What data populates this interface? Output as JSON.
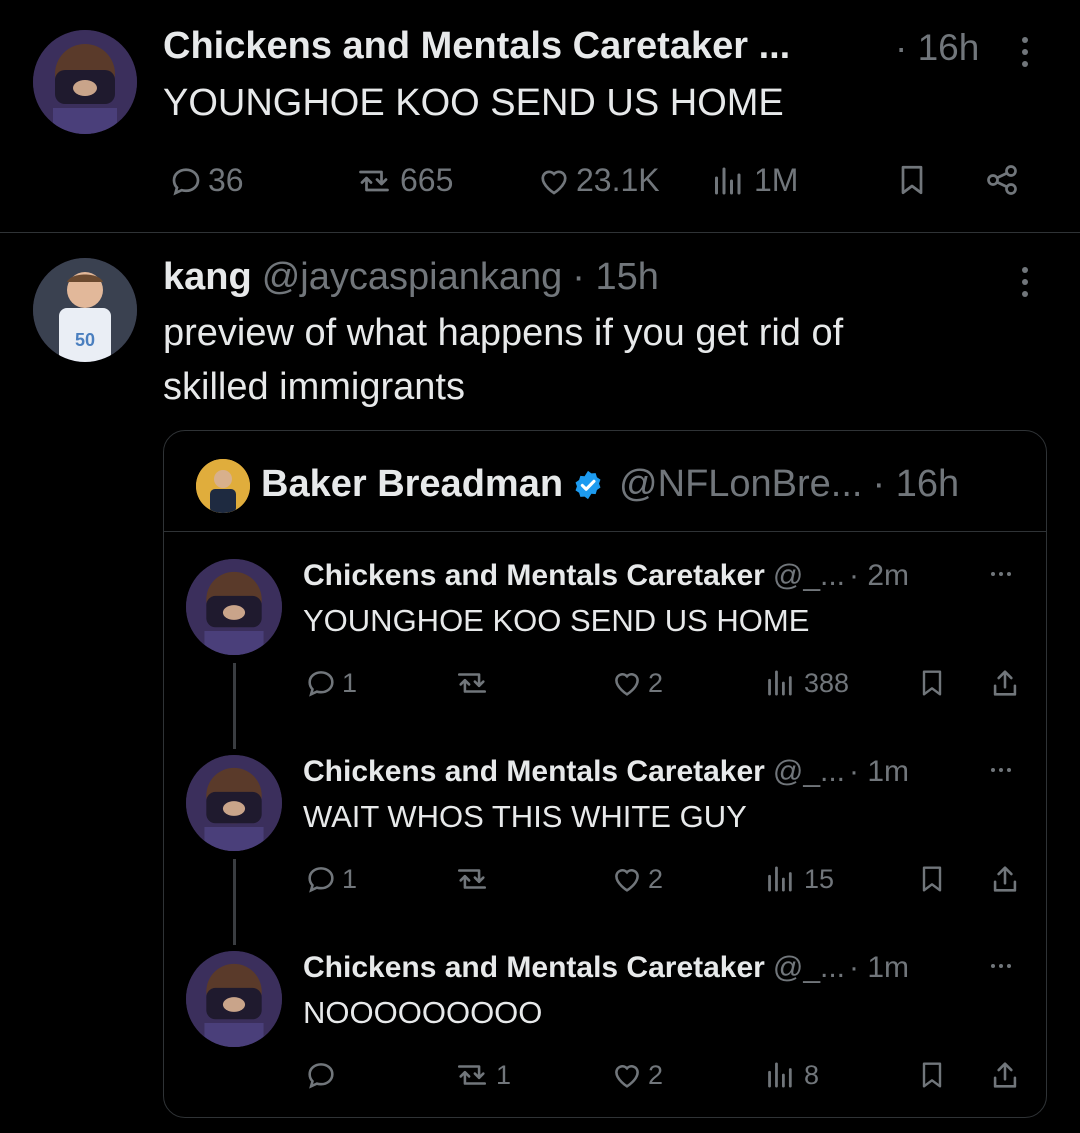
{
  "tweet1": {
    "name": "Chickens and Mentals Caretaker ...",
    "time": "· 16h",
    "text": "YOUNGHOE KOO SEND US HOME",
    "actions": {
      "replies": "36",
      "reposts": "665",
      "likes": "23.1K",
      "views": "1M"
    },
    "icons": [
      "reply-icon",
      "repost-icon",
      "like-icon",
      "views-icon",
      "bookmark-icon",
      "share-icon",
      "more-icon"
    ]
  },
  "tweet2": {
    "name": "kang",
    "handle": "@jaycaspiankang",
    "time": "· 15h",
    "text_line1": "preview of what happens if you get rid of",
    "text_line2": "skilled immigrants",
    "avatar_jersey": "50",
    "quote": {
      "name": "Baker Breadman",
      "handle": "@NFLonBre...",
      "time": "· 16h",
      "thread": [
        {
          "name": "Chickens and Mentals Caretaker",
          "handle": "@_...",
          "time": "· 2m",
          "text": "YOUNGHOE KOO SEND US HOME",
          "replies": "1",
          "reposts": "",
          "likes": "2",
          "views": "388"
        },
        {
          "name": "Chickens and Mentals Caretaker",
          "handle": "@_...",
          "time": "· 1m",
          "text": "WAIT WHOS THIS WHITE GUY",
          "replies": "1",
          "reposts": "",
          "likes": "2",
          "views": "15"
        },
        {
          "name": "Chickens and Mentals Caretaker",
          "handle": "@_...",
          "time": "· 1m",
          "text": "NOOOOOOOOO",
          "replies": "",
          "reposts": "1",
          "likes": "2",
          "views": "8"
        }
      ]
    }
  },
  "colors": {
    "background": "#000000",
    "text": "#e7e9ea",
    "muted": "#71767b",
    "border": "#2f3336",
    "verified": "#1d9bf0"
  }
}
